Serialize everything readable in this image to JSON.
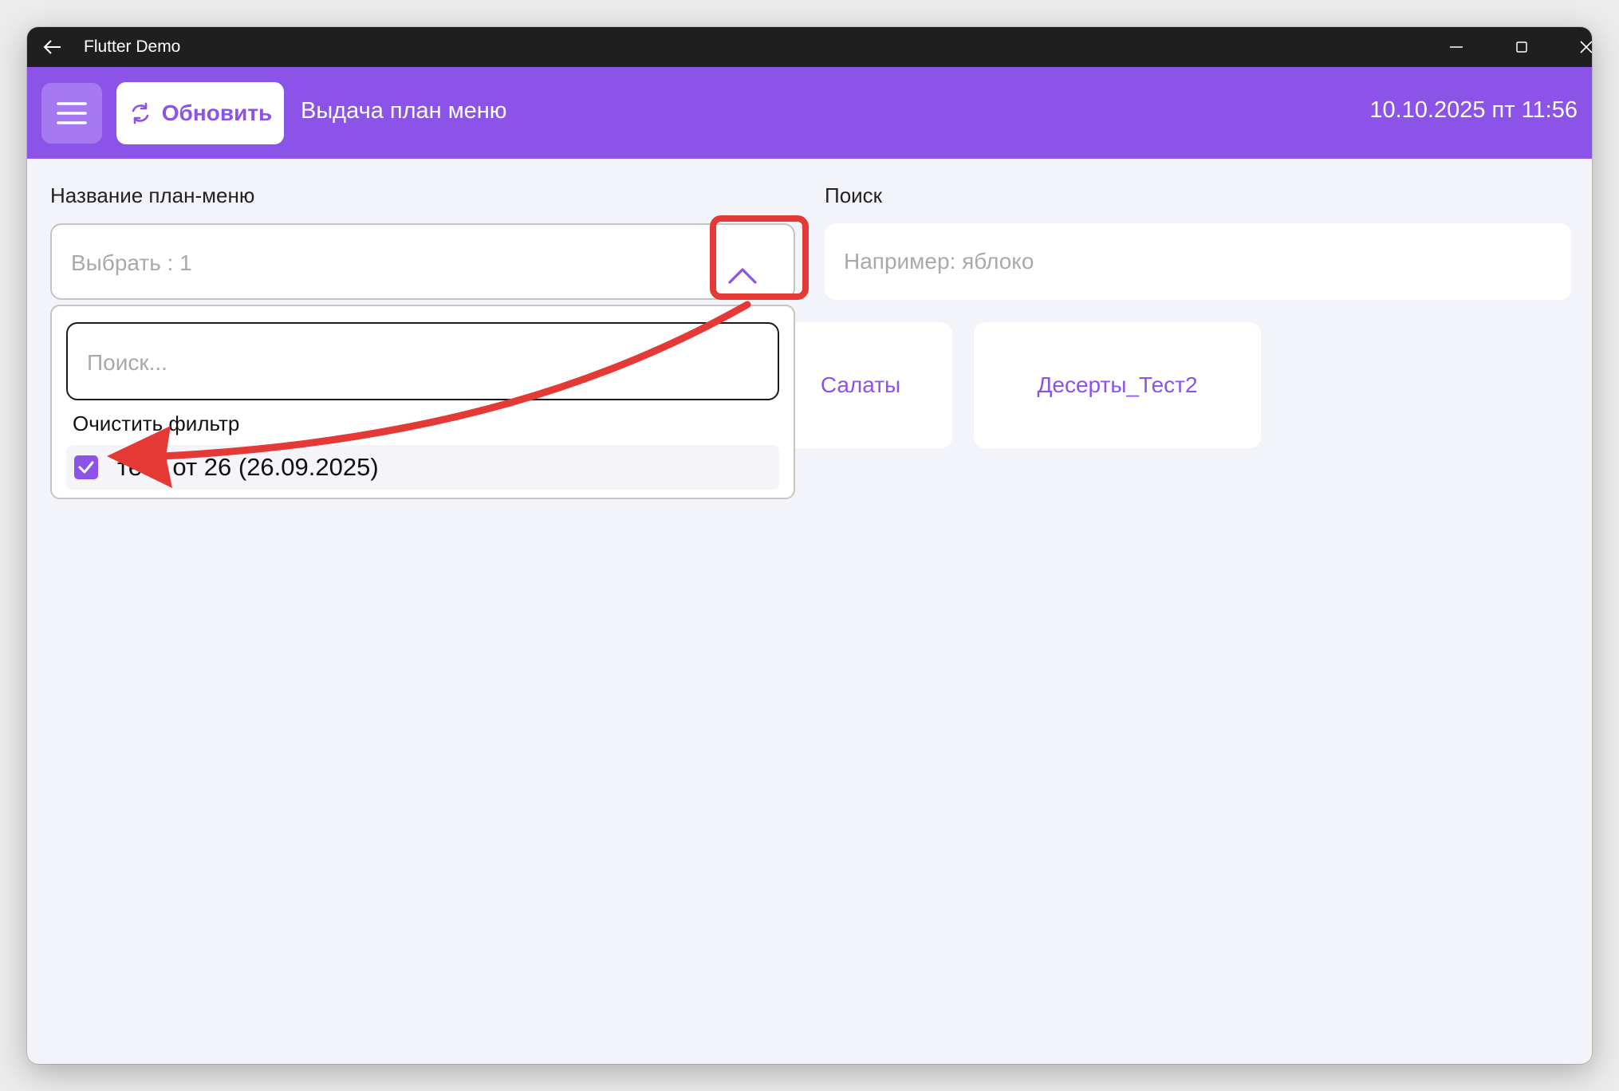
{
  "window": {
    "title": "Flutter Demo"
  },
  "appbar": {
    "refresh_label": "Обновить",
    "title": "Выдача план меню",
    "datetime": "10.10.2025 пт 11:56",
    "background_color": "#8b53e8"
  },
  "form": {
    "plan_menu_label": "Название план-меню",
    "plan_menu_placeholder": "Выбрать : 1",
    "search_label": "Поиск",
    "search_placeholder": "Например: яблоко"
  },
  "dropdown": {
    "search_placeholder": "Поиск...",
    "clear_filter": "Очистить фильтр",
    "options": [
      {
        "label": "тест от 26 (26.09.2025)",
        "checked": true
      }
    ]
  },
  "categories": [
    {
      "label": "Салаты"
    },
    {
      "label": "Десерты_Тест2"
    }
  ],
  "icons": {
    "back": "back-arrow-icon",
    "minimize": "minimize-icon",
    "maximize": "maximize-icon",
    "close": "close-icon",
    "menu": "hamburger-menu-icon",
    "refresh": "refresh-icon",
    "chevron": "chevron-up-icon",
    "check": "checkmark-icon"
  },
  "annotation": {
    "color": "#e53935"
  }
}
